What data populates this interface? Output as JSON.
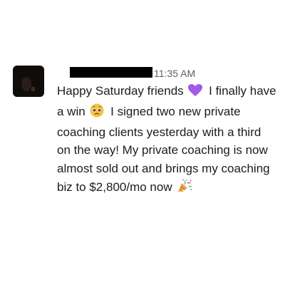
{
  "message": {
    "timestamp": "11:35 AM",
    "text_part1": "Happy Saturday friends",
    "emoji1_icon": "purple-heart-icon",
    "text_part2": "I finally have a win",
    "emoji2_icon": "pleading-face-icon",
    "text_part3": "I signed two new private coaching clients yesterday with a third on the way! My private coaching is now almost sold out and brings my coaching biz to $2,800/mo now",
    "emoji3_icon": "party-popper-icon"
  },
  "colors": {
    "text": "#1d1c1d",
    "timestamp": "#616061",
    "heart": "#a259e6",
    "redaction": "#000000"
  }
}
